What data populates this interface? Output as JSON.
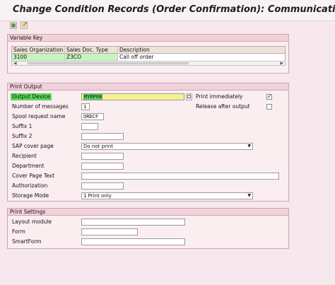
{
  "window": {
    "title": "Change Condition Records (Order Confirmation): Communication"
  },
  "variable_key": {
    "group_title": "Variable Key",
    "columns": [
      "Sales Organization",
      "Sales Doc. Type",
      "Description"
    ],
    "row": {
      "sales_org": "3100",
      "doc_type": "Z3CO",
      "description": "Call off order"
    }
  },
  "print_output": {
    "group_title": "Print Output",
    "labels": {
      "output_device": "Output Device",
      "num_messages": "Number of messages",
      "spool_name": "Spool request name",
      "suffix1": "Suffix 1",
      "suffix2": "Suffix 2",
      "cover_page": "SAP cover page",
      "recipient": "Recipient",
      "department": "Department",
      "cover_text": "Cover Page Text",
      "authorization": "Authorization",
      "storage_mode": "Storage Mode",
      "print_immediately": "Print immediately",
      "release_after": "Release after output"
    },
    "values": {
      "output_device": "MYRP08",
      "num_messages": "1",
      "spool_name": "ORDCF",
      "cover_page": "Do not print",
      "storage_mode": "1 Print only",
      "print_immediately_checked": true,
      "release_after_checked": false
    }
  },
  "print_settings": {
    "group_title": "Print Settings",
    "labels": {
      "layout_module": "Layout module",
      "form": "Form",
      "smartform": "SmartForm"
    }
  }
}
